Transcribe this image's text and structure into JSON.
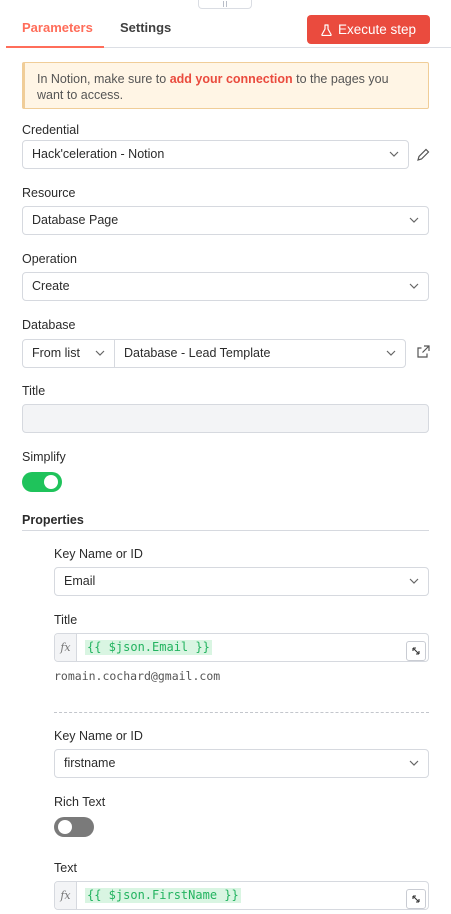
{
  "tabs": [
    {
      "label": "Parameters",
      "active": true
    },
    {
      "label": "Settings",
      "active": false
    }
  ],
  "execute_button": {
    "label": "Execute step",
    "icon": "flask-icon"
  },
  "notice": {
    "prefix": "In Notion, make sure to ",
    "link": "add your connection",
    "suffix": " to the pages you want to access."
  },
  "credential": {
    "label": "Credential",
    "value": "Hack'celeration - Notion"
  },
  "resource": {
    "label": "Resource",
    "value": "Database Page"
  },
  "operation": {
    "label": "Operation",
    "value": "Create"
  },
  "database": {
    "label": "Database",
    "mode": "From list",
    "value": "Database - Lead Template"
  },
  "title": {
    "label": "Title",
    "value": ""
  },
  "simplify": {
    "label": "Simplify",
    "on": true
  },
  "properties": {
    "label": "Properties",
    "items": [
      {
        "key_label": "Key Name or ID",
        "key_value": "Email",
        "field_label": "Title",
        "expression": "{{ $json.Email }}",
        "result": "romain.cochard@gmail.com"
      },
      {
        "key_label": "Key Name or ID",
        "key_value": "firstname",
        "rich_text_label": "Rich Text",
        "rich_text_on": false,
        "field_label": "Text",
        "expression": "{{ $json.FirstName }}"
      }
    ]
  },
  "colors": {
    "accent": "#ff6d5a",
    "execute": "#ea4b3e",
    "toggle_on": "#1fc35b",
    "expression": "#22b35f"
  }
}
